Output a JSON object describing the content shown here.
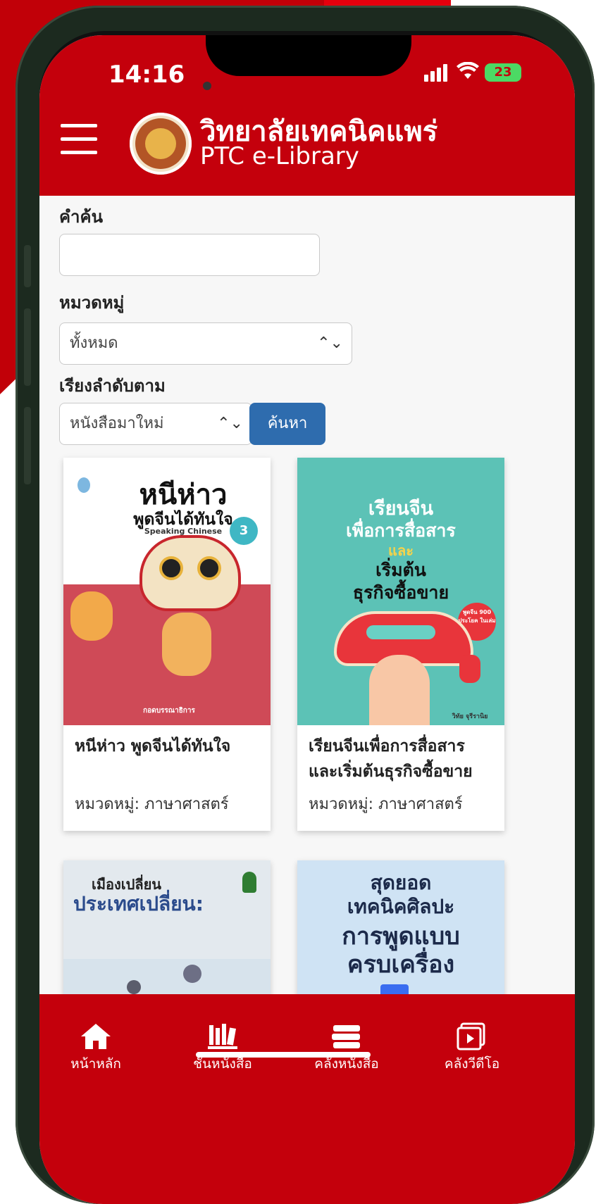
{
  "status_bar": {
    "time": "14:16",
    "battery": "23"
  },
  "header": {
    "title_th": "วิทยาลัยเทคนิคแพร่",
    "title_en": "PTC e-Library"
  },
  "search": {
    "keyword_label": "คำค้น",
    "keyword_value": "",
    "category_label": "หมวดหมู่",
    "category_selected": "ทั้งหมด",
    "sort_label": "เรียงลำดับตาม",
    "sort_selected": "หนังสือมาใหม่",
    "search_button": "ค้นหา"
  },
  "books": [
    {
      "title": "หนีห่าว พูดจีนได้ทันใจ",
      "category": "หมวดหมู่: ภาษาศาสตร์",
      "cover_lines": [
        "หนีห่าว",
        "พูดจีนได้ทันใจ",
        "Speaking Chinese",
        "3",
        "กอดบรรณาธิการ"
      ]
    },
    {
      "title": "เรียนจีนเพื่อการสื่อสาร และเริ่มต้นธุรกิจซื้อขาย",
      "category": "หมวดหมู่: ภาษาศาสตร์",
      "cover_lines": [
        "เรียนจีน",
        "เพื่อการสื่อสาร",
        "และ",
        "เริ่มต้น",
        "ธุรกิจซื้อขาย",
        "พูดจีน 900 ประโยค ในเล่ม",
        "วิทัย จุรีรานิย"
      ]
    },
    {
      "title": "",
      "category": "",
      "cover_lines": [
        "เมืองเปลี่ยน",
        "ประเทศเปลี่ยน:"
      ]
    },
    {
      "title": "",
      "category": "",
      "cover_lines": [
        "สุดยอด",
        "เทคนิคศิลปะ",
        "การพูดแบบ",
        "ครบเครื่อง"
      ]
    }
  ],
  "bottom_nav": [
    {
      "label": "หน้าหลัก",
      "icon": "home-icon"
    },
    {
      "label": "ชั้นหนังสือ",
      "icon": "bookshelf-icon"
    },
    {
      "label": "คลังหนังสือ",
      "icon": "book-stack-icon"
    },
    {
      "label": "คลังวีดีโอ",
      "icon": "video-library-icon"
    }
  ],
  "colors": {
    "brand_red": "#c4000c",
    "button_blue": "#2e6cae",
    "battery_green": "#4cd964"
  }
}
